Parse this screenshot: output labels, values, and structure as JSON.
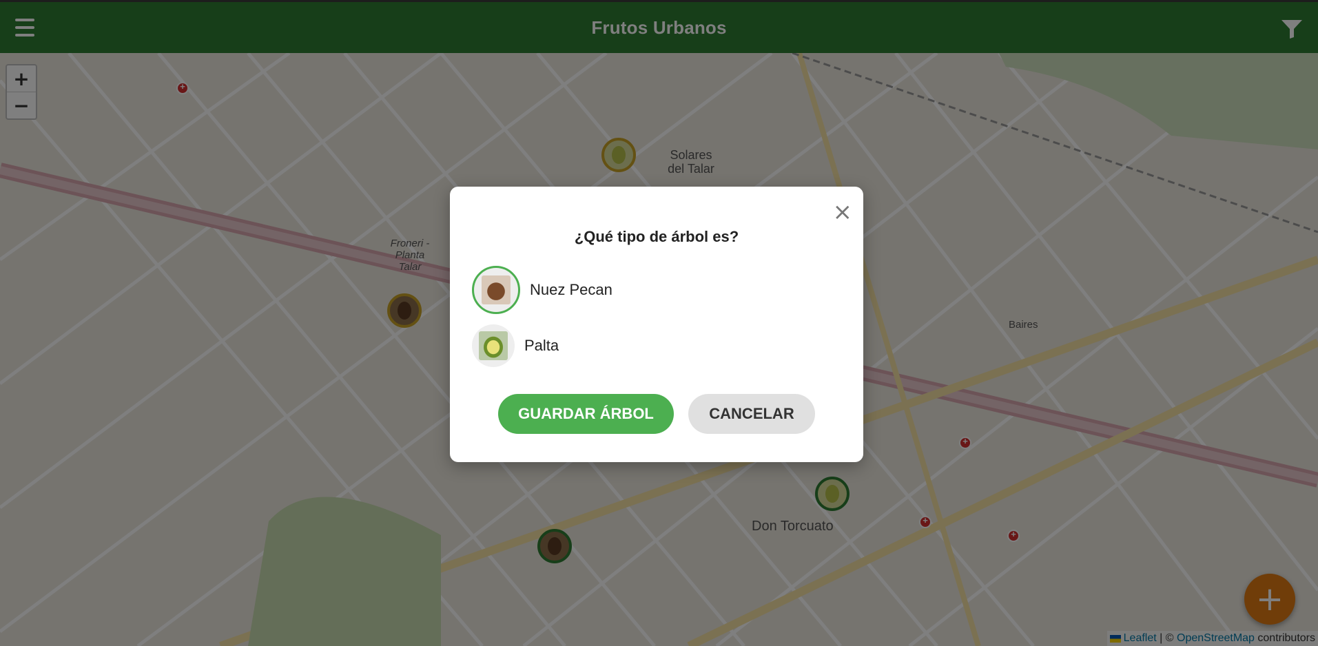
{
  "header": {
    "title": "Frutos Urbanos",
    "menu_icon": "menu-icon",
    "filter_icon": "filter-icon"
  },
  "map": {
    "zoom_in": "+",
    "zoom_out": "−",
    "place_labels": {
      "solares": "Solares del Talar",
      "froneri": "Froneri - Planta Talar",
      "don_torcuato": "Don Torcuato",
      "baires": "Baires"
    },
    "attribution": {
      "leaflet": "Leaflet",
      "separator": "| ©",
      "osm": "OpenStreetMap",
      "contributors": "contributors"
    }
  },
  "fab": {
    "label": "+"
  },
  "modal": {
    "title": "¿Qué tipo de árbol es?",
    "close": "×",
    "options": [
      {
        "label": "Nuez Pecan",
        "selected": true,
        "icon": "nuez-pecan-icon"
      },
      {
        "label": "Palta",
        "selected": false,
        "icon": "palta-icon"
      }
    ],
    "save_label": "GUARDAR ÁRBOL",
    "cancel_label": "CANCELAR"
  },
  "colors": {
    "header": "#2e7d32",
    "accent": "#4caf50",
    "fab": "#e07a13",
    "pin": "#d32f2f"
  }
}
